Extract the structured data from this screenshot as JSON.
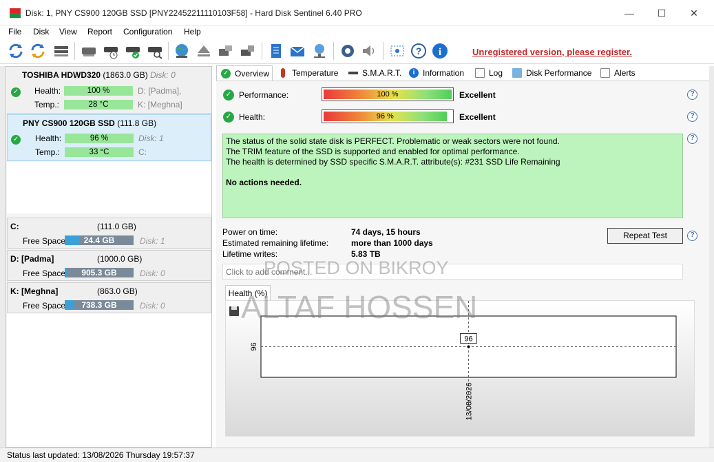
{
  "window": {
    "title": "Disk: 1, PNY CS900 120GB SSD [PNY22452211110103F58]  -  Hard Disk Sentinel 6.40 PRO",
    "minimize": "—",
    "maximize": "☐",
    "close": "✕"
  },
  "menu": [
    "File",
    "Disk",
    "View",
    "Report",
    "Configuration",
    "Help"
  ],
  "toolbar": {
    "register_text": "Unregistered version, please register."
  },
  "disks": [
    {
      "name": "TOSHIBA HDWD320",
      "size": "(1863.0 GB)",
      "disk_label": "Disk: 0",
      "health_label": "Health:",
      "health_value": "100 %",
      "temp_label": "Temp.:",
      "temp_value": "28 °C",
      "side1": "D: [Padma],",
      "side2": "K: [Meghna]"
    },
    {
      "name": "PNY CS900 120GB SSD",
      "size": "(111.8 GB)",
      "disk_label": "",
      "health_label": "Health:",
      "health_value": "96 %",
      "temp_label": "Temp.:",
      "temp_value": "33 °C",
      "side1": "Disk: 1",
      "side2": "C:"
    }
  ],
  "volumes": [
    {
      "name": "C:",
      "size": "(111.0 GB)",
      "free_label": "Free Space",
      "free_value": "24.4 GB",
      "free_fraction": 0.22,
      "disk": "Disk: 1"
    },
    {
      "name": "D: [Padma]",
      "size": "(1000.0 GB)",
      "free_label": "Free Space",
      "free_value": "905.3 GB",
      "free_fraction": 0.05,
      "disk": "Disk: 0"
    },
    {
      "name": "K: [Meghna]",
      "size": "(863.0 GB)",
      "free_label": "Free Space",
      "free_value": "738.3 GB",
      "free_fraction": 0.14,
      "disk": "Disk: 0"
    }
  ],
  "tabs": [
    "Overview",
    "Temperature",
    "S.M.A.R.T.",
    "Information",
    "Log",
    "Disk Performance",
    "Alerts"
  ],
  "overview": {
    "performance_label": "Performance:",
    "performance_value": "100 %",
    "performance_result": "Excellent",
    "health_label": "Health:",
    "health_value": "96 %",
    "health_result": "Excellent",
    "status_lines": [
      "The status of the solid state disk is PERFECT. Problematic or weak sectors were not found.",
      "The TRIM feature of the SSD is supported and enabled for optimal performance.",
      "The health is determined by SSD specific S.M.A.R.T. attribute(s):  #231 SSD Life Remaining"
    ],
    "status_action": "No actions needed.",
    "power_on_label": "Power on time:",
    "power_on_value": "74 days, 15 hours",
    "lifetime_label": "Estimated remaining lifetime:",
    "lifetime_value": "more than 1000 days",
    "writes_label": "Lifetime writes:",
    "writes_value": "5.83 TB",
    "repeat_test": "Repeat Test",
    "comment_placeholder": "Click to add comment...",
    "help": "?"
  },
  "chart_data": {
    "type": "line",
    "title": "Health (%)",
    "x": [
      "13/08/2026"
    ],
    "series": [
      {
        "values": [
          96
        ]
      }
    ],
    "ytick": "96",
    "data_label": "96"
  },
  "watermarks": [
    "POSTED ON BIKROY",
    "ALTAF HOSSEN"
  ],
  "statusbar": {
    "text": "Status last updated: 13/08/2026 Thursday 19:57:37"
  }
}
